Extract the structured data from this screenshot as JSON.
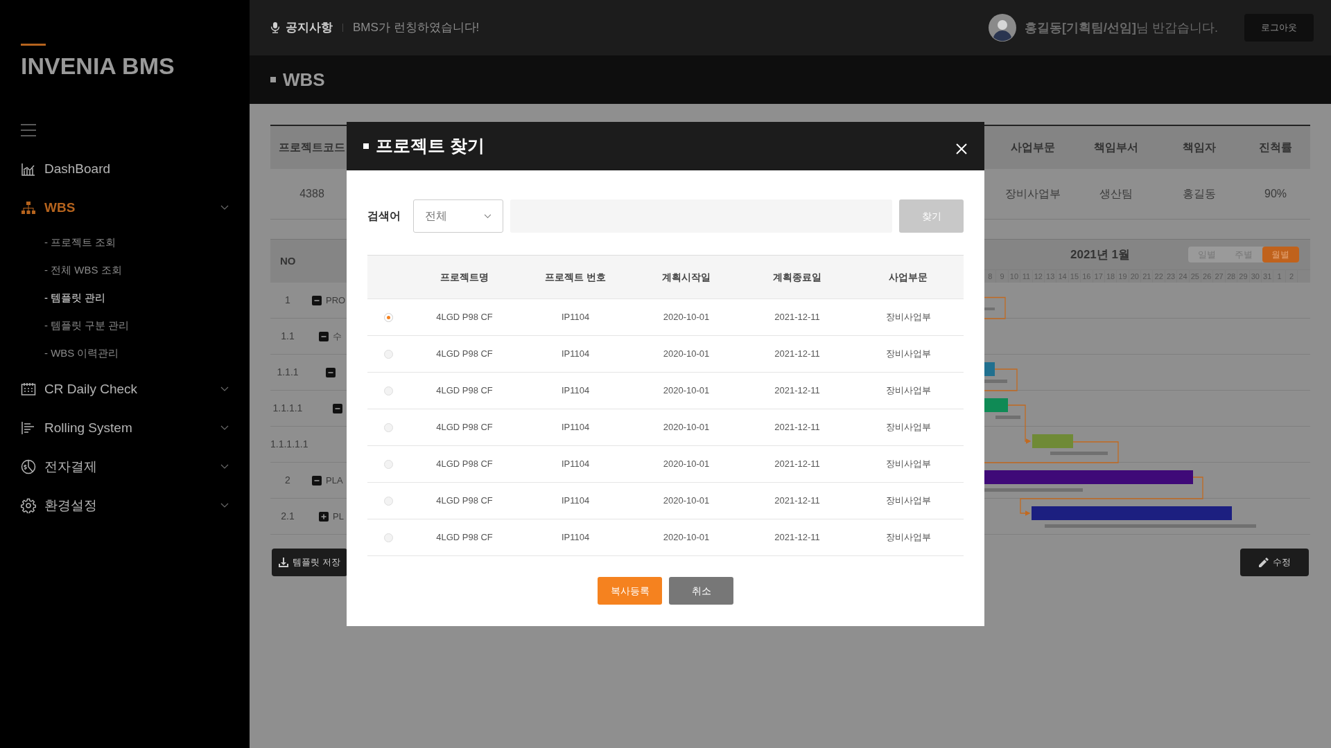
{
  "sidebar": {
    "logo": "INVENIA BMS",
    "menu": [
      {
        "label": "DashBoard",
        "selected": false,
        "kind": "link"
      },
      {
        "label": "WBS",
        "selected": true,
        "kind": "submenu",
        "children": [
          {
            "label": "- 프로젝트 조회",
            "selected": false
          },
          {
            "label": "- 전체 WBS 조회",
            "selected": false
          },
          {
            "label": "- 템플릿 관리",
            "selected": true
          },
          {
            "label": "- 템플릿 구분 관리",
            "selected": false
          },
          {
            "label": "- WBS 이력관리",
            "selected": false
          }
        ]
      },
      {
        "label": "CR Daily Check",
        "selected": false,
        "kind": "submenu"
      },
      {
        "label": "Rolling System",
        "selected": false,
        "kind": "submenu"
      },
      {
        "label": "전자결제",
        "selected": false,
        "kind": "submenu"
      },
      {
        "label": "환경설정",
        "selected": false,
        "kind": "submenu"
      }
    ]
  },
  "topbar": {
    "notice_label": "공지사항",
    "notice": "BMS가 런칭하였습니다!",
    "greeting": "**홍길동[기획팀/선임]**님 반갑습니다.",
    "logout": "로그아웃"
  },
  "page_title": "WBS",
  "project_table": {
    "columns": [
      "프로젝트코드",
      "사업부문",
      "책임부서",
      "책임자",
      "진척률"
    ],
    "row": [
      "4388",
      "장비사업부",
      "생산팀",
      "홍길동",
      "90%"
    ]
  },
  "gantt": {
    "no_header": "NO",
    "month": "2021년 1월",
    "views": [
      {
        "label": "일별",
        "selected": false
      },
      {
        "label": "주별",
        "selected": false
      },
      {
        "label": "월별",
        "selected": true
      }
    ],
    "days": [
      "8",
      "9",
      "10",
      "11",
      "12",
      "13",
      "14",
      "15",
      "16",
      "17",
      "18",
      "19",
      "20",
      "21",
      "22",
      "23",
      "24",
      "25",
      "26",
      "27",
      "28",
      "29",
      "30",
      "31",
      "1",
      "2"
    ],
    "tasks": [
      {
        "no": "1",
        "label": "PRO",
        "expanded": true,
        "children": [
          {
            "no": "1.1",
            "label": "수",
            "expanded": true,
            "children": [
              {
                "no": "1.1.1",
                "expanded": true,
                "children": [
                  {
                    "no": "1.1.1.1",
                    "expanded": true,
                    "children": [
                      {
                        "no": "1.1.1.1.1"
                      }
                    ]
                  }
                ]
              }
            ]
          }
        ]
      },
      {
        "no": "2",
        "label": "PLA",
        "expanded": true,
        "children": [
          {
            "no": "2.1",
            "label": "PL",
            "expanded": false
          }
        ]
      }
    ]
  },
  "buttons": {
    "template_save": "템플릿 저장",
    "edit": "수정"
  },
  "modal": {
    "title": "프로젝트 찾기",
    "search_label": "검색어",
    "scope": "전체",
    "search_button": "찾기",
    "columns": [
      "프로젝트명",
      "프로젝트 번호",
      "계획시작일",
      "계획종료일",
      "사업부문"
    ],
    "rows": [
      {
        "selected": true,
        "cells": [
          "4LGD P98 CF",
          "IP1104",
          "2020-10-01",
          "2021-12-11",
          "장비사업부"
        ]
      },
      {
        "selected": false,
        "cells": [
          "4LGD P98 CF",
          "IP1104",
          "2020-10-01",
          "2021-12-11",
          "장비사업부"
        ]
      },
      {
        "selected": false,
        "cells": [
          "4LGD P98 CF",
          "IP1104",
          "2020-10-01",
          "2021-12-11",
          "장비사업부"
        ]
      },
      {
        "selected": false,
        "cells": [
          "4LGD P98 CF",
          "IP1104",
          "2020-10-01",
          "2021-12-11",
          "장비사업부"
        ]
      },
      {
        "selected": false,
        "cells": [
          "4LGD P98 CF",
          "IP1104",
          "2020-10-01",
          "2021-12-11",
          "장비사업부"
        ]
      },
      {
        "selected": false,
        "cells": [
          "4LGD P98 CF",
          "IP1104",
          "2020-10-01",
          "2021-12-11",
          "장비사업부"
        ]
      },
      {
        "selected": false,
        "cells": [
          "4LGD P98 CF",
          "IP1104",
          "2020-10-01",
          "2021-12-11",
          "장비사업부"
        ]
      }
    ],
    "buttons": [
      "복사등록",
      "취소"
    ]
  }
}
